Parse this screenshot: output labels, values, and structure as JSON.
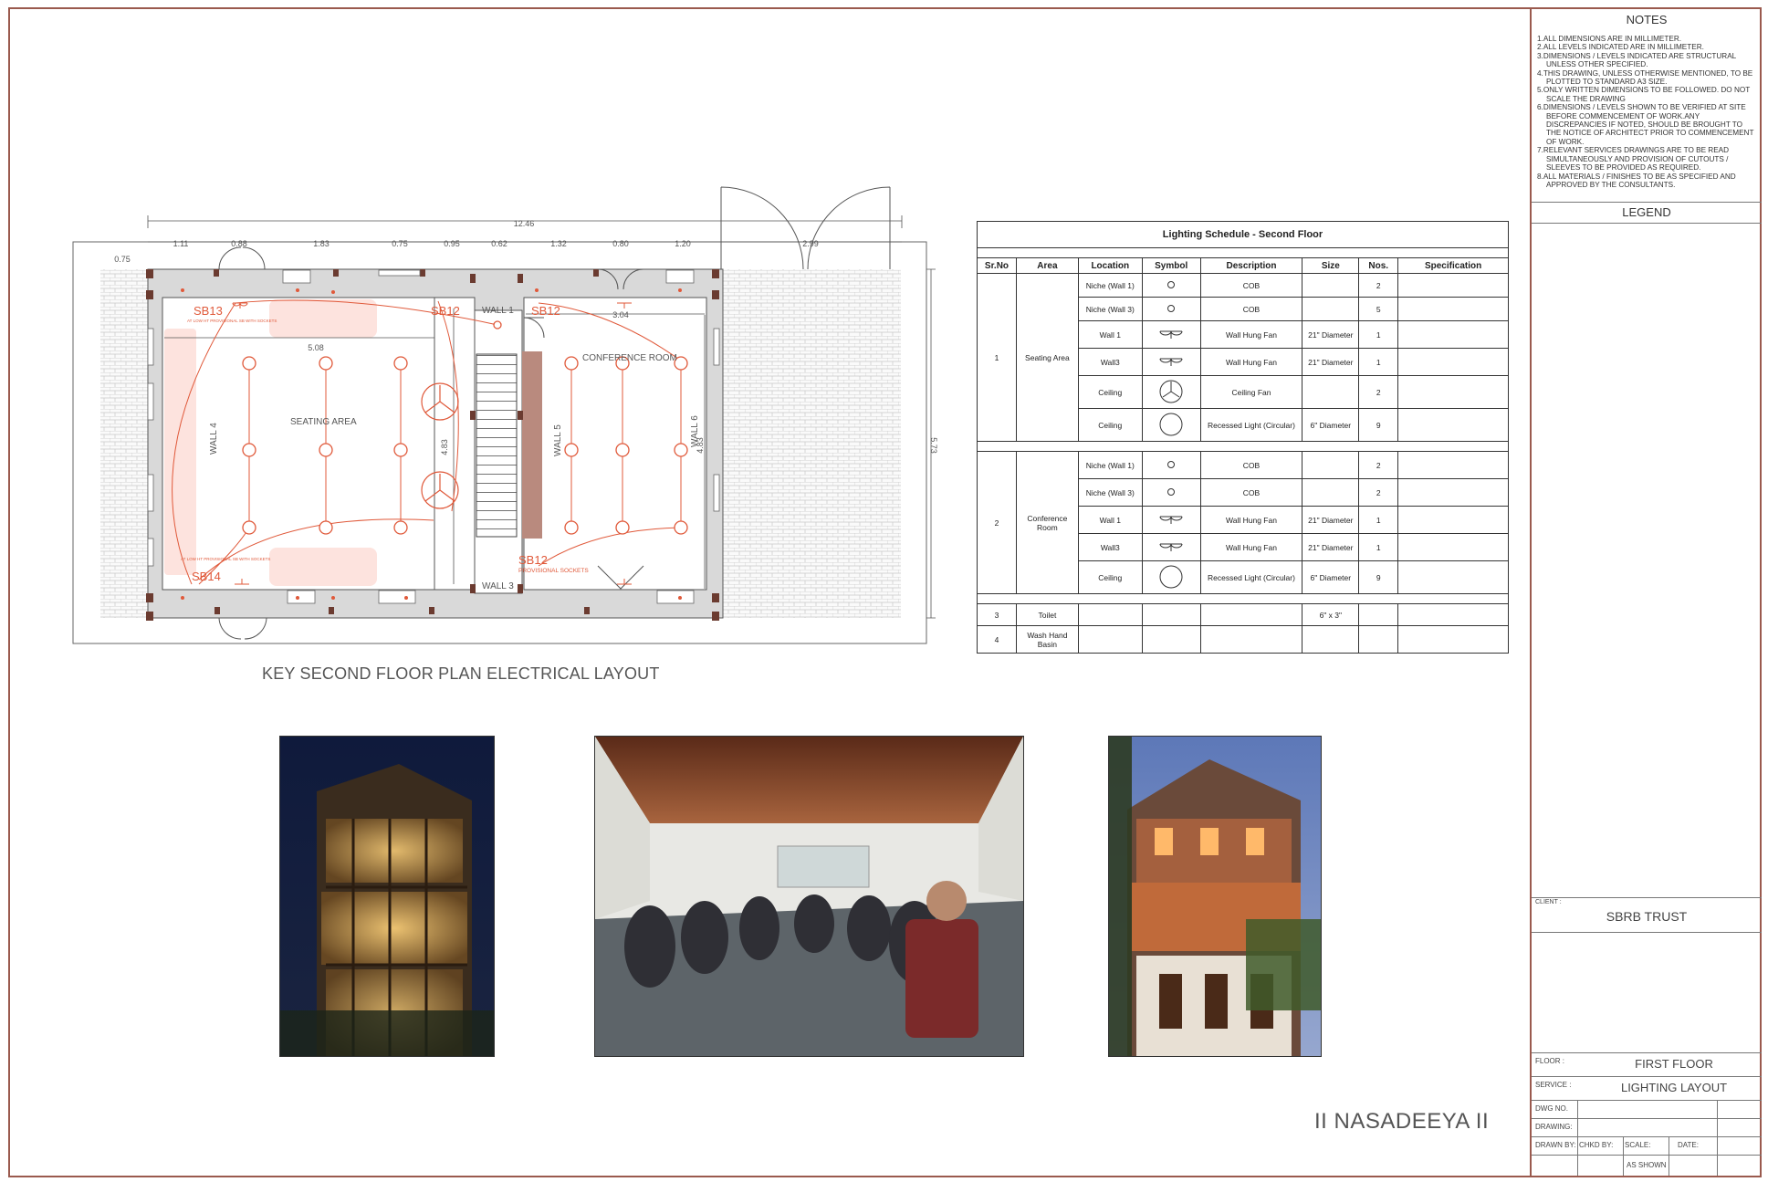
{
  "notes": {
    "title": "NOTES",
    "items": [
      "1.ALL DIMENSIONS ARE IN MILLIMETER.",
      "2.ALL LEVELS INDICATED ARE IN MILLIMETER.",
      "3.DIMENSIONS / LEVELS INDICATED ARE STRUCTURAL UNLESS OTHER SPECIFIED.",
      "4.THIS DRAWING, UNLESS OTHERWISE MENTIONED, TO BE PLOTTED TO STANDARD A3 SIZE.",
      "5.ONLY WRITTEN DIMENSIONS TO BE FOLLOWED. DO NOT SCALE THE DRAWING",
      "6.DIMENSIONS / LEVELS SHOWN TO BE VERIFIED AT SITE BEFORE COMMENCEMENT OF WORK.ANY DISCREPANCIES IF NOTED, SHOULD BE BROUGHT TO THE NOTICE OF ARCHITECT PRIOR TO COMMENCEMENT OF WORK.",
      "7.RELEVANT SERVICES DRAWINGS ARE TO BE READ SIMULTANEOUSLY AND PROVISION OF CUTOUTS / SLEEVES TO BE PROVIDED AS REQUIRED.",
      "8.ALL MATERIALS / FINISHES TO BE AS SPECIFIED AND APPROVED BY THE CONSULTANTS."
    ]
  },
  "legend": {
    "title": "LEGEND"
  },
  "titleblock": {
    "client_label": "CLIENT :",
    "client_value": "SBRB TRUST",
    "floor_label": "FLOOR :",
    "floor_value": "FIRST FLOOR",
    "service_label": "SERVICE :",
    "service_value": "LIGHTING LAYOUT",
    "dwg_no_label": "DWG NO.",
    "drawing_label": "DRAWING:",
    "drawn_by_label": "DRAWN BY:",
    "chkd_by_label": "CHKD BY:",
    "scale_label": "SCALE:",
    "date_label": "DATE:",
    "scale_value": "AS SHOWN"
  },
  "plan": {
    "title": "KEY SECOND FLOOR PLAN ELECTRICAL LAYOUT",
    "dim_total": "12.46",
    "dims_top": [
      "1.11",
      "0.88",
      "1.83",
      "0.75",
      "0.95",
      "0.62",
      "1.32",
      "0.80",
      "1.20",
      "2.99"
    ],
    "dim_left": "0.75",
    "dim_seating": "5.08",
    "dim_conf": "3.04",
    "dim_stair": "4.83",
    "dim_conf_v": "4.83",
    "dim_right": "5.73",
    "seating_area": "SEATING AREA",
    "conference_room": "CONFERENCE ROOM",
    "wall1": "WALL 1",
    "wall3": "WALL 3",
    "wall4": "WALL 4",
    "wall5": "WALL 5",
    "wall6": "WALL 6",
    "sb13": "SB13",
    "sb12a": "SB12",
    "sb12b": "SB12",
    "sb14": "SB14",
    "sb12c": "SB12",
    "sb13_note": "AT LOW HT PROVISIONAL SB WITH SOCKETS",
    "sb14_note": "AT LOW HT PROVISIONAL SB WITH SOCKETS",
    "sb12c_note": "PROVISIONAL SOCKETS"
  },
  "schedule": {
    "title": "Lighting Schedule - Second Floor",
    "headers": [
      "Sr.No",
      "Area",
      "Location",
      "Symbol",
      "Description",
      "Size",
      "Nos.",
      "Specification"
    ],
    "g1_no": "1",
    "g1_area": "Seating Area",
    "g1": [
      {
        "loc": "Niche (Wall 1)",
        "desc": "COB",
        "size": "",
        "nos": "2"
      },
      {
        "loc": "Niche (Wall 3)",
        "desc": "COB",
        "size": "",
        "nos": "5"
      },
      {
        "loc": "Wall 1",
        "desc": "Wall Hung Fan",
        "size": "21\" Diameter",
        "nos": "1"
      },
      {
        "loc": "Wall3",
        "desc": "Wall Hung Fan",
        "size": "21\" Diameter",
        "nos": "1"
      },
      {
        "loc": "Ceiling",
        "desc": "Ceiling Fan",
        "size": "",
        "nos": "2"
      },
      {
        "loc": "Ceiling",
        "desc": "Recessed Light (Circular)",
        "size": "6\" Diameter",
        "nos": "9"
      }
    ],
    "g2_no": "2",
    "g2_area": "Conference Room",
    "g2": [
      {
        "loc": "Niche (Wall 1)",
        "desc": "COB",
        "size": "",
        "nos": "2"
      },
      {
        "loc": "Niche (Wall 3)",
        "desc": "COB",
        "size": "",
        "nos": "2"
      },
      {
        "loc": "Wall 1",
        "desc": "Wall Hung Fan",
        "size": "21\" Diameter",
        "nos": "1"
      },
      {
        "loc": "Wall3",
        "desc": "Wall Hung Fan",
        "size": "21\" Diameter",
        "nos": "1"
      },
      {
        "loc": "Ceiling",
        "desc": "Recessed Light (Circular)",
        "size": "6\" Diameter",
        "nos": "9"
      }
    ],
    "g3_no": "3",
    "g3_area": "Toilet",
    "g3_size": "6\" x 3\"",
    "g4_no": "4",
    "g4_area": "Wash Hand Basin"
  },
  "brand": "II NASADEEYA II",
  "colors": {
    "frame": "#9a5a4e",
    "electrical": "#e0593a",
    "zone_fill": "#fde3de"
  }
}
